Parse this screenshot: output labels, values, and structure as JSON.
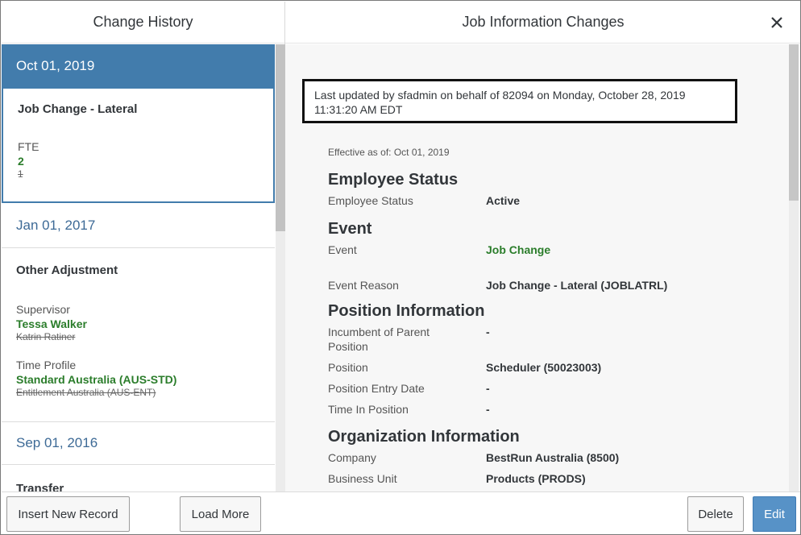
{
  "left": {
    "title": "Change History",
    "entries": [
      {
        "date": "Oct 01, 2019",
        "title": "Job Change - Lateral",
        "fields": [
          {
            "label": "FTE",
            "new": "2",
            "old": "1"
          }
        ]
      },
      {
        "date": "Jan 01, 2017",
        "title": "Other Adjustment",
        "fields": [
          {
            "label": "Supervisor",
            "new": "Tessa Walker",
            "old": "Katrin Ratiner"
          },
          {
            "label": "Time Profile",
            "new": "Standard Australia (AUS-STD)",
            "old": "Entitlement Australia (AUS-ENT)"
          }
        ]
      },
      {
        "date": "Sep 01, 2016",
        "title": "Transfer"
      }
    ],
    "insert_button": "Insert New Record",
    "load_more_button": "Load More"
  },
  "right": {
    "title": "Job Information Changes",
    "close_icon": "close-icon",
    "updated_line1": "Last updated by sfadmin on behalf of 82094 on Monday, October 28, 2019",
    "updated_line2": "11:31:20 AM EDT",
    "effective": "Effective as of: Oct 01, 2019",
    "sections": {
      "employee_status": {
        "title": "Employee Status",
        "rows": [
          {
            "label": "Employee Status",
            "value": "Active"
          }
        ]
      },
      "event": {
        "title": "Event",
        "rows": [
          {
            "label": "Event",
            "value": "Job Change"
          },
          {
            "label": "Event Reason",
            "value": "Job Change - Lateral (JOBLATRL)"
          }
        ]
      },
      "position": {
        "title": "Position Information",
        "rows": [
          {
            "label": "Incumbent of Parent Position",
            "value": "-"
          },
          {
            "label": "Position",
            "value": "Scheduler (50023003)"
          },
          {
            "label": "Position Entry Date",
            "value": "-"
          },
          {
            "label": "Time In Position",
            "value": "-"
          }
        ]
      },
      "organization": {
        "title": "Organization Information",
        "rows": [
          {
            "label": "Company",
            "value": "BestRun Australia (8500)"
          },
          {
            "label": "Business Unit",
            "value": "Products (PRODS)"
          }
        ]
      }
    },
    "delete_button": "Delete",
    "edit_button": "Edit"
  },
  "colors": {
    "selected": "#427cac",
    "changed_value": "#2b7d2b",
    "edit_button": "#5792c7"
  }
}
